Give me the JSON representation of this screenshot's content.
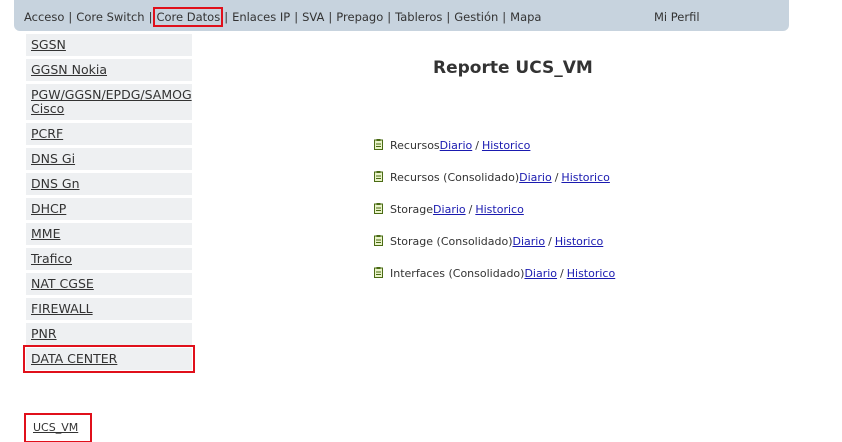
{
  "topnav": {
    "items": [
      "Acceso",
      "Core Switch",
      "Core Datos",
      "Enlaces IP",
      "SVA",
      "Prepago",
      "Tableros",
      "Gestión",
      "Mapa"
    ],
    "profile": "Mi Perfil"
  },
  "sidebar": {
    "items": [
      "SGSN",
      "GGSN Nokia",
      "PGW/GGSN/EPDG/SAMOG Cisco",
      "PCRF",
      "DNS Gi",
      "DNS Gn",
      "DHCP",
      "MME",
      "Trafico",
      "NAT CGSE",
      "FIREWALL",
      "PNR",
      "DATA CENTER"
    ],
    "sub_item": "UCS_VM"
  },
  "main": {
    "title": "Reporte UCS_VM",
    "reports": [
      {
        "label": "Recursos",
        "daily": " Diario ",
        "history": "Historico"
      },
      {
        "label": "Recursos (Consolidado)",
        "daily": " Diario ",
        "history": "Historico"
      },
      {
        "label": "Storage",
        "daily": " Diario ",
        "history": "Historico"
      },
      {
        "label": "Storage (Consolidado)",
        "daily": " Diario ",
        "history": "Historico"
      },
      {
        "label": "Interfaces (Consolidado)",
        "daily": " Diario ",
        "history": "Historico"
      }
    ],
    "separator": "/"
  },
  "colors": {
    "nav_bg": "#c7d3de",
    "highlight": "#e0101b",
    "link": "#1a1ab0",
    "sidebar_bg": "#eef0f2"
  }
}
